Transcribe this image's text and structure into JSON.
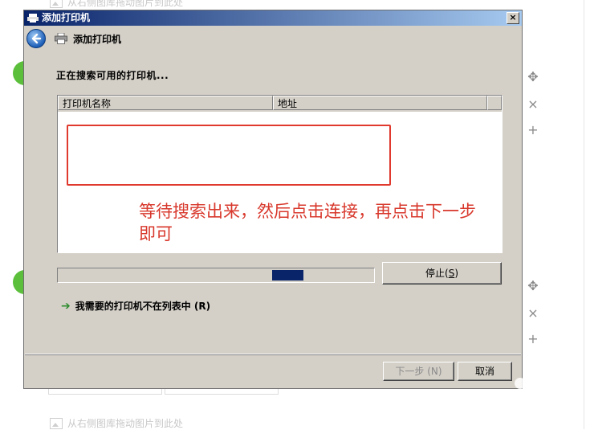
{
  "background": {
    "hint_text": "从右侧图库拖动图片到此处",
    "controls": [
      "move-icon",
      "close-icon",
      "plus-icon"
    ],
    "accent_green": "#5cbf3c"
  },
  "dialog": {
    "window_title": "添加打印机",
    "header_title": "添加打印机",
    "status_text": "正在搜索可用的打印机...",
    "columns": [
      "打印机名称",
      "地址"
    ],
    "progress_fraction": 0.1,
    "progress_position": 0.75,
    "stop_label_prefix": "停止(",
    "stop_label_key": "S",
    "stop_label_suffix": ")",
    "not_listed_text": "我需要的打印机不在列表中 (R)",
    "next_label": "下一步 (N)",
    "cancel_label": "取消"
  },
  "annotation": {
    "text": "等待搜索出来，然后点击连接，再点击下一步即可",
    "color": "#d8382c"
  }
}
